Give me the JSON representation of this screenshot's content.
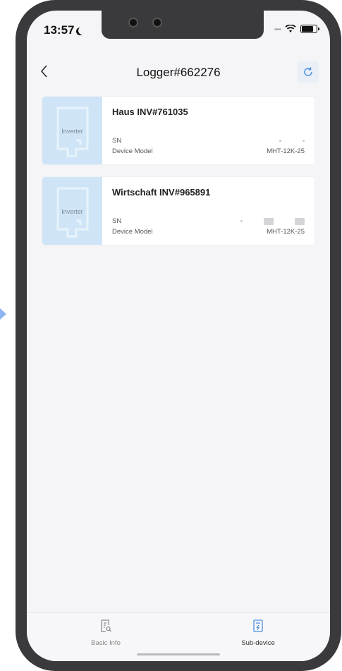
{
  "status_bar": {
    "time": "13:57"
  },
  "nav": {
    "title": "Logger#662276"
  },
  "devices": [
    {
      "thumb_label": "Inverter",
      "name": "Haus INV#761035",
      "sn_label": "SN",
      "model_label": "Device Model",
      "model_value": "MHT-12K-25"
    },
    {
      "thumb_label": "Inverter",
      "name": "Wirtschaft INV#965891",
      "sn_label": "SN",
      "model_label": "Device Model",
      "model_value": "MHT-12K-25"
    }
  ],
  "tabbar": {
    "tabs": [
      {
        "label": "Basic Info",
        "icon": "document-search-icon"
      },
      {
        "label": "Sub-device",
        "icon": "inverter-device-icon"
      }
    ]
  },
  "colors": {
    "accent": "#4a8fe2",
    "thumb_bg": "#cfe5f7",
    "frame": "#3a3a3c"
  }
}
